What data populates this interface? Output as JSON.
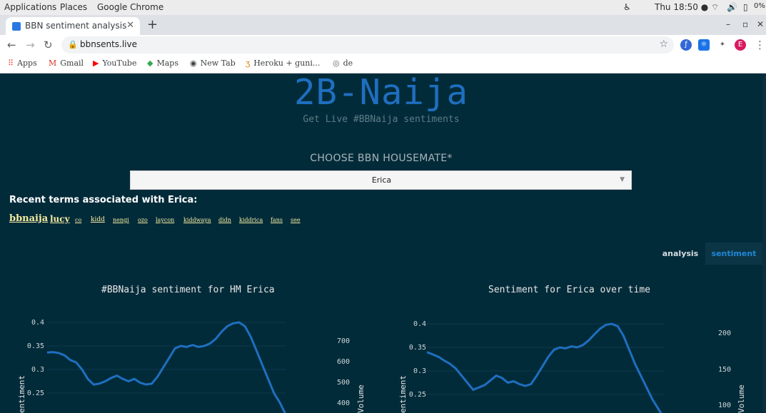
{
  "os": {
    "menu": [
      "Applications",
      "Places",
      "Google Chrome"
    ],
    "clock": "Thu 18:50 ●",
    "battery": "0%"
  },
  "browser": {
    "tab_title": "BBN sentiment analysis",
    "url": "bbnsents.live",
    "profile_initial": "E",
    "bookmarks": [
      "Apps",
      "Gmail",
      "YouTube",
      "Maps",
      "New Tab",
      "Heroku + guni...",
      "de"
    ]
  },
  "page": {
    "brand": "2B-Naija",
    "tagline": "Get Live #BBNaija sentiments",
    "choose_label": "CHOOSE BBN HOUSEMATE*",
    "selected_housemate": "Erica",
    "recent_heading": "Recent terms associated with Erica:",
    "terms": [
      "bbnaija",
      "lucy",
      "co",
      "kidd",
      "nengi",
      "ozo",
      "laycon",
      "kiddwaya",
      "didn",
      "kiddrica",
      "fans",
      "see"
    ],
    "view_tabs": [
      "analysis",
      "sentiment"
    ],
    "active_tab": "sentiment",
    "accent_color": "#1f6fbf"
  },
  "chart_data": [
    {
      "type": "line",
      "title": "#BBNaija sentiment for HM Erica",
      "ylabel": "entiment",
      "y2label": "Volume",
      "yticks": [
        "0.4",
        "0.35",
        "0.3",
        "0.25"
      ],
      "y2ticks": [
        "700",
        "600",
        "500",
        "400"
      ],
      "ylim": [
        0.2,
        0.4
      ],
      "series": [
        {
          "values": [
            0.336,
            0.337,
            0.335,
            0.33,
            0.32,
            0.315,
            0.3,
            0.28,
            0.268,
            0.27,
            0.275,
            0.282,
            0.287,
            0.28,
            0.275,
            0.28,
            0.272,
            0.268,
            0.27,
            0.285,
            0.305,
            0.325,
            0.345,
            0.35,
            0.348,
            0.352,
            0.348,
            0.35,
            0.355,
            0.365,
            0.38,
            0.392,
            0.398,
            0.4,
            0.392,
            0.37,
            0.34,
            0.31,
            0.28,
            0.25,
            0.23,
            0.205
          ]
        }
      ]
    },
    {
      "type": "line",
      "title": "Sentiment for Erica over time",
      "ylabel": "entiment",
      "y2label": "Volume",
      "yticks": [
        "0.4",
        "0.35",
        "0.3",
        "0.25"
      ],
      "y2ticks": [
        "200",
        "150",
        "100"
      ],
      "ylim": [
        0.2,
        0.4
      ],
      "series": [
        {
          "values": [
            0.34,
            0.335,
            0.33,
            0.322,
            0.315,
            0.305,
            0.29,
            0.275,
            0.26,
            0.265,
            0.27,
            0.28,
            0.29,
            0.285,
            0.275,
            0.278,
            0.272,
            0.268,
            0.272,
            0.29,
            0.31,
            0.33,
            0.345,
            0.35,
            0.348,
            0.352,
            0.35,
            0.355,
            0.365,
            0.378,
            0.39,
            0.398,
            0.4,
            0.395,
            0.375,
            0.345,
            0.315,
            0.29,
            0.265,
            0.24,
            0.22,
            0.2
          ]
        }
      ]
    }
  ]
}
